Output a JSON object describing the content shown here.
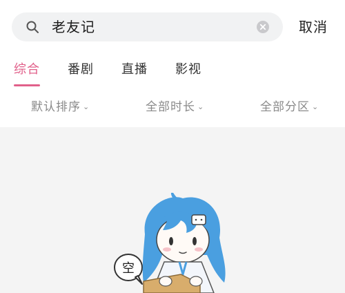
{
  "search": {
    "query": "老友记",
    "cancel_label": "取消"
  },
  "tabs": [
    {
      "label": "综合",
      "active": true
    },
    {
      "label": "番剧",
      "active": false
    },
    {
      "label": "直播",
      "active": false
    },
    {
      "label": "影视",
      "active": false
    }
  ],
  "filters": [
    {
      "label": "默认排序"
    },
    {
      "label": "全部时长"
    },
    {
      "label": "全部分区"
    }
  ],
  "empty_state": {
    "bubble_text": "空"
  },
  "colors": {
    "accent": "#e1608a",
    "mascot_hair": "#4a9fe0"
  }
}
